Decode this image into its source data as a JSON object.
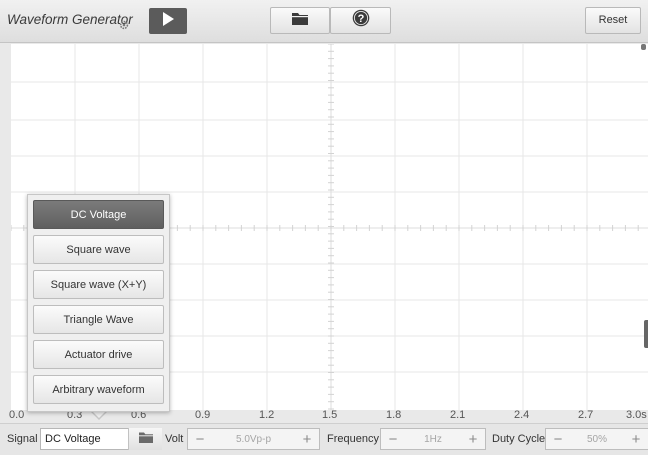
{
  "toolbar": {
    "title": "Waveform Generator",
    "reset_label": "Reset",
    "icons": {
      "play": "play-icon",
      "folder": "folder-icon",
      "help": "help-icon",
      "settings": "gear-icon"
    }
  },
  "plot": {
    "x_axis_labels": [
      "0.0",
      "0.3",
      "0.6",
      "0.9",
      "1.2",
      "1.5",
      "1.8",
      "2.1",
      "2.4",
      "2.7",
      "3.0s"
    ]
  },
  "signal_menu": {
    "items": [
      {
        "label": "DC Voltage",
        "selected": true
      },
      {
        "label": "Square wave",
        "selected": false
      },
      {
        "label": "Square wave (X+Y)",
        "selected": false
      },
      {
        "label": "Triangle Wave",
        "selected": false
      },
      {
        "label": "Actuator drive",
        "selected": false
      },
      {
        "label": "Arbitrary waveform",
        "selected": false
      }
    ]
  },
  "controls": {
    "signal_label": "Signal",
    "signal_value": "DC Voltage",
    "volt_label": "Volt",
    "volt_value": "5.0Vp-p",
    "frequency_label": "Frequency",
    "frequency_value": "1Hz",
    "duty_label": "Duty Cycle",
    "duty_value": "50%",
    "minus_symbol": "−",
    "plus_symbol": "+"
  },
  "colors": {
    "toolbar_bg": "#e6e6e6",
    "plot_bg": "#ffffff",
    "grid": "#e6e6e6",
    "selected_item": "#6b6b6b",
    "play_button": "#5b5b5b"
  }
}
